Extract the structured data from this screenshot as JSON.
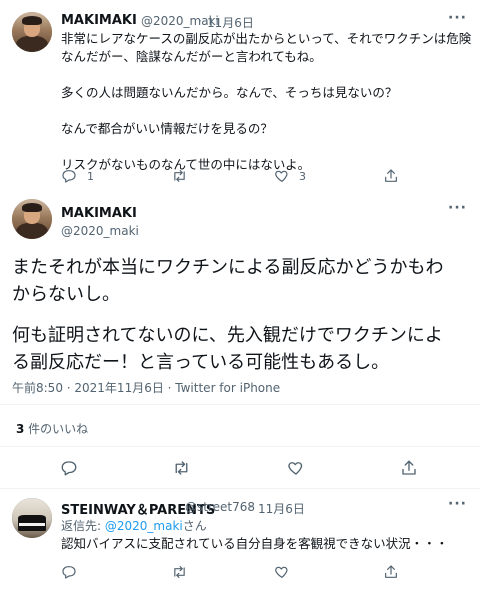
{
  "tweet1": {
    "name": "MAKIMAKI",
    "handle": "@2020_maki",
    "sep": "·",
    "date": "11月6日",
    "lines": [
      "非常にレアなケースの副反応が出たからといって、それでワクチンは危険",
      "なんだがー、陰謀なんだがーと言われてもね。",
      "多くの人は問題ないんだから。なんで、そっちは見ないの？",
      "なんで都合がいい情報だけを見るの？",
      "リスクがないものなんて世の中にはないよ。"
    ],
    "reply_count": "1",
    "like_count": "3"
  },
  "main": {
    "name": "MAKIMAKI",
    "handle": "@2020_maki",
    "lines": [
      "またそれが本当にワクチンによる副反応かどうかもわ",
      "からないし。",
      "何も証明されてないのに、先入観だけでワクチンによ",
      "る副反応だー！と言っている可能性もあるし。"
    ],
    "timestamp": "午前8:50 · 2021年11月6日 · Twitter for iPhone",
    "likes_number": "3",
    "likes_label": " 件のいいね"
  },
  "reply": {
    "name": "STEINWAY＆PARENTS",
    "handle": "@street768",
    "sep": "·",
    "date": "11月6日",
    "reply_to_prefix": "返信先: ",
    "reply_to_handle": "@2020_maki",
    "reply_to_suffix": "さん",
    "text": "認知バイアスに支配されている自分自身を客観視できない状況・・・"
  },
  "icons": {
    "more": "more-dots-icon",
    "reply": "reply-icon",
    "retweet": "retweet-icon",
    "like": "heart-icon",
    "share": "share-icon"
  },
  "colors": {
    "text": "#0f1419",
    "secondary": "#536471",
    "link": "#1d9bf0",
    "divider": "#eff3f4"
  },
  "more_glyph": "···"
}
